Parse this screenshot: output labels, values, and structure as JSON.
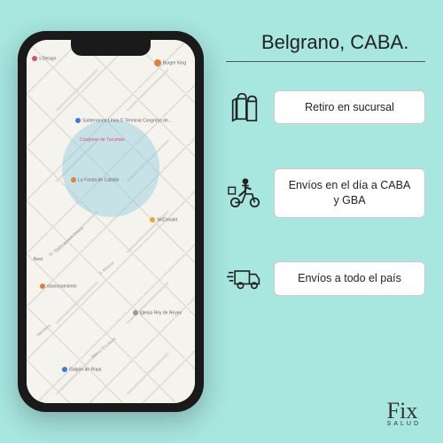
{
  "location_title": "Belgrano, CABA.",
  "features": [
    {
      "icon": "shopping-bag",
      "label": "Retiro en sucursal"
    },
    {
      "icon": "delivery-scooter",
      "label": "Envíos en el día a CABA y GBA"
    },
    {
      "icon": "shipping-truck",
      "label": "Envíos a todo el país"
    }
  ],
  "map": {
    "pois": {
      "design": "s Design",
      "burger": "Burger King",
      "subte": "Subterraneo Línea D Terminal Congreso de...",
      "congreso": "Congreso de Tucumán",
      "farola": "La Farola de Cabildo",
      "mcdonald": "McDonald",
      "best": "Best",
      "estacionamiento": "stacionamiento",
      "iglesia": "Iglesia Rey de Reyes",
      "galpon": "Galpón de Ropa"
    },
    "streets": {
      "rivera": "Dr. Pedro Ignacio Rivera",
      "moreno": "V. Moreno",
      "encalada": "Blanco Encalada",
      "mendoza": "Mendoza"
    }
  },
  "logo": {
    "main": "Fix",
    "sub": "SALUD"
  }
}
